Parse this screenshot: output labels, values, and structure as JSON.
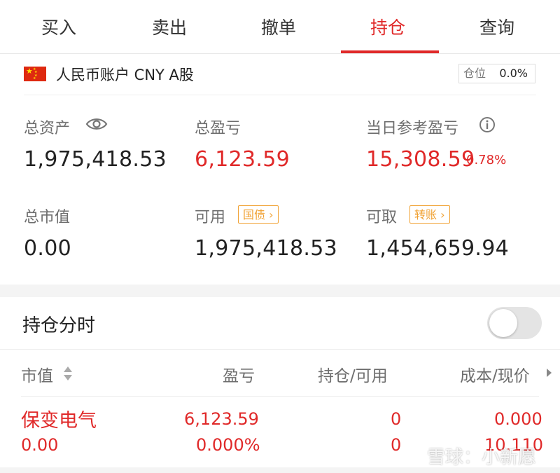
{
  "tabs": [
    {
      "label": "买入"
    },
    {
      "label": "卖出"
    },
    {
      "label": "撤单"
    },
    {
      "label": "持仓",
      "active": true
    },
    {
      "label": "查询"
    }
  ],
  "account": {
    "name": "人民币账户 CNY A股",
    "position_label": "仓位",
    "position_value": "0.0%"
  },
  "summary": {
    "total_assets_label": "总资产",
    "total_assets": "1,975,418.53",
    "total_pnl_label": "总盈亏",
    "total_pnl": "6,123.59",
    "daily_pnl_label": "当日参考盈亏",
    "daily_pnl": "15,308.59",
    "daily_pnl_pct": "0.78%",
    "market_value_label": "总市值",
    "market_value": "0.00",
    "available_label": "可用",
    "available_tag": "国债",
    "available": "1,975,418.53",
    "withdrawable_label": "可取",
    "withdrawable_tag": "转账",
    "withdrawable": "1,454,659.94"
  },
  "holdings": {
    "title": "持仓分时",
    "toggle_on": false,
    "columns": [
      "市值",
      "盈亏",
      "持仓/可用",
      "成本/现价"
    ],
    "rows": [
      {
        "name": "保变电气",
        "market_value": "0.00",
        "pnl": "6,123.59",
        "pnl_pct": "0.000%",
        "position": "0",
        "available": "0",
        "cost": "0.000",
        "price": "10.110"
      }
    ]
  },
  "watermark": "雪球：小新愿",
  "colors": {
    "accent_red": "#e02929",
    "tag_orange": "#f0a030"
  }
}
